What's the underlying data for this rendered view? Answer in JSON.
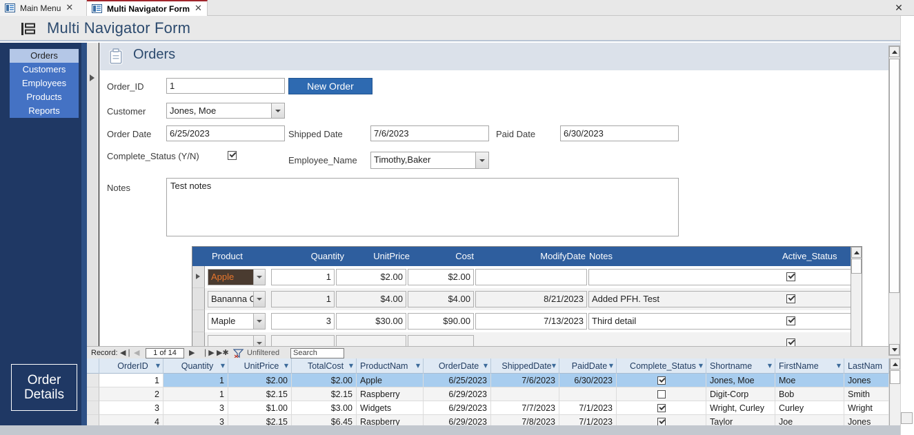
{
  "window": {
    "close_label": "✕",
    "accent_blue": "#2e5e9e",
    "nav_dark": "#1f3864",
    "nav_mid": "#4472c4"
  },
  "tabs": [
    {
      "label": "Main Menu",
      "icon": "form-icon",
      "close": "✕",
      "active": false
    },
    {
      "label": "Multi Navigator Form",
      "icon": "form-icon",
      "close": "✕",
      "active": true
    }
  ],
  "titlebar": {
    "icon": "navigator-form-icon",
    "title": "Multi Navigator Form"
  },
  "sidebar": {
    "items": [
      {
        "label": "Orders",
        "selected": true
      },
      {
        "label": "Customers",
        "selected": false
      },
      {
        "label": "Employees",
        "selected": false
      },
      {
        "label": "Products",
        "selected": false
      },
      {
        "label": "Reports",
        "selected": false
      }
    ]
  },
  "form": {
    "header_icon": "clipboard-icon",
    "header_title": "Orders",
    "fields": {
      "order_id_label": "Order_ID",
      "order_id_value": "1",
      "new_order_button": "New Order",
      "customer_label": "Customer",
      "customer_value": "Jones, Moe",
      "order_date_label": "Order Date",
      "order_date_value": "6/25/2023",
      "shipped_date_label": "Shipped Date",
      "shipped_date_value": "7/6/2023",
      "paid_date_label": "Paid Date",
      "paid_date_value": "6/30/2023",
      "complete_status_label": "Complete_Status (Y/N)",
      "complete_status_checked": true,
      "employee_name_label": "Employee_Name",
      "employee_name_value": "Timothy,Baker",
      "notes_label": "Notes",
      "notes_value": "Test notes"
    }
  },
  "subform": {
    "columns": [
      "Product",
      "Quantity",
      "UnitPrice",
      "Cost",
      "ModifyDate",
      "Notes",
      "Active_Status"
    ],
    "rows": [
      {
        "product": "Apple",
        "quantity": "1",
        "unitprice": "$2.00",
        "cost": "$2.00",
        "modifydate": "",
        "notes": "",
        "active": true,
        "current": true,
        "product_selected": true
      },
      {
        "product": "Bananna C",
        "quantity": "1",
        "unitprice": "$4.00",
        "cost": "$4.00",
        "modifydate": "8/21/2023",
        "notes": "Added PFH. Test",
        "active": true,
        "current": false,
        "product_selected": false
      },
      {
        "product": "Maple",
        "quantity": "3",
        "unitprice": "$30.00",
        "cost": "$90.00",
        "modifydate": "7/13/2023",
        "notes": "Third detail",
        "active": true,
        "current": false,
        "product_selected": false
      }
    ]
  },
  "recordnav": {
    "record_label": "Record:",
    "first": "◀❘",
    "prev": "◀",
    "position": "1 of 14",
    "next": "▶",
    "last": "❘▶",
    "new": "▶✱",
    "filter_icon": "filter-icon",
    "filter_label": "Unfiltered",
    "search_placeholder": "Search"
  },
  "orderdetails": {
    "panel_line1": "Order",
    "panel_line2": "Details",
    "columns": [
      "OrderID",
      "Quantity",
      "UnitPrice",
      "TotalCost",
      "ProductNam",
      "OrderDate",
      "ShippedDate",
      "PaidDate",
      "Complete_Status",
      "Shortname",
      "FirstName",
      "LastNam"
    ],
    "sort_glyph": "▼",
    "rows": [
      {
        "orderid": "1",
        "quantity": "1",
        "unitprice": "$2.00",
        "totalcost": "$2.00",
        "productname": "Apple",
        "orderdate": "6/25/2023",
        "shippeddate": "7/6/2023",
        "paiddate": "6/30/2023",
        "complete": true,
        "shortname": "Jones, Moe",
        "firstname": "Moe",
        "lastname": "Jones",
        "state": "selected"
      },
      {
        "orderid": "2",
        "quantity": "1",
        "unitprice": "$2.15",
        "totalcost": "$2.15",
        "productname": "Raspberry",
        "orderdate": "6/29/2023",
        "shippeddate": "",
        "paiddate": "",
        "complete": false,
        "shortname": "Digit-Corp",
        "firstname": "Bob",
        "lastname": "Smith",
        "state": "alt"
      },
      {
        "orderid": "3",
        "quantity": "3",
        "unitprice": "$1.00",
        "totalcost": "$3.00",
        "productname": "Widgets",
        "orderdate": "6/29/2023",
        "shippeddate": "7/7/2023",
        "paiddate": "7/1/2023",
        "complete": true,
        "shortname": "Wright, Curley",
        "firstname": "Curley",
        "lastname": "Wright",
        "state": "plain"
      },
      {
        "orderid": "4",
        "quantity": "3",
        "unitprice": "$2.15",
        "totalcost": "$6.45",
        "productname": "Raspberry",
        "orderdate": "6/29/2023",
        "shippeddate": "7/8/2023",
        "paiddate": "7/1/2023",
        "complete": true,
        "shortname": "Taylor",
        "firstname": "Joe",
        "lastname": "Jones",
        "state": "alt"
      }
    ]
  }
}
